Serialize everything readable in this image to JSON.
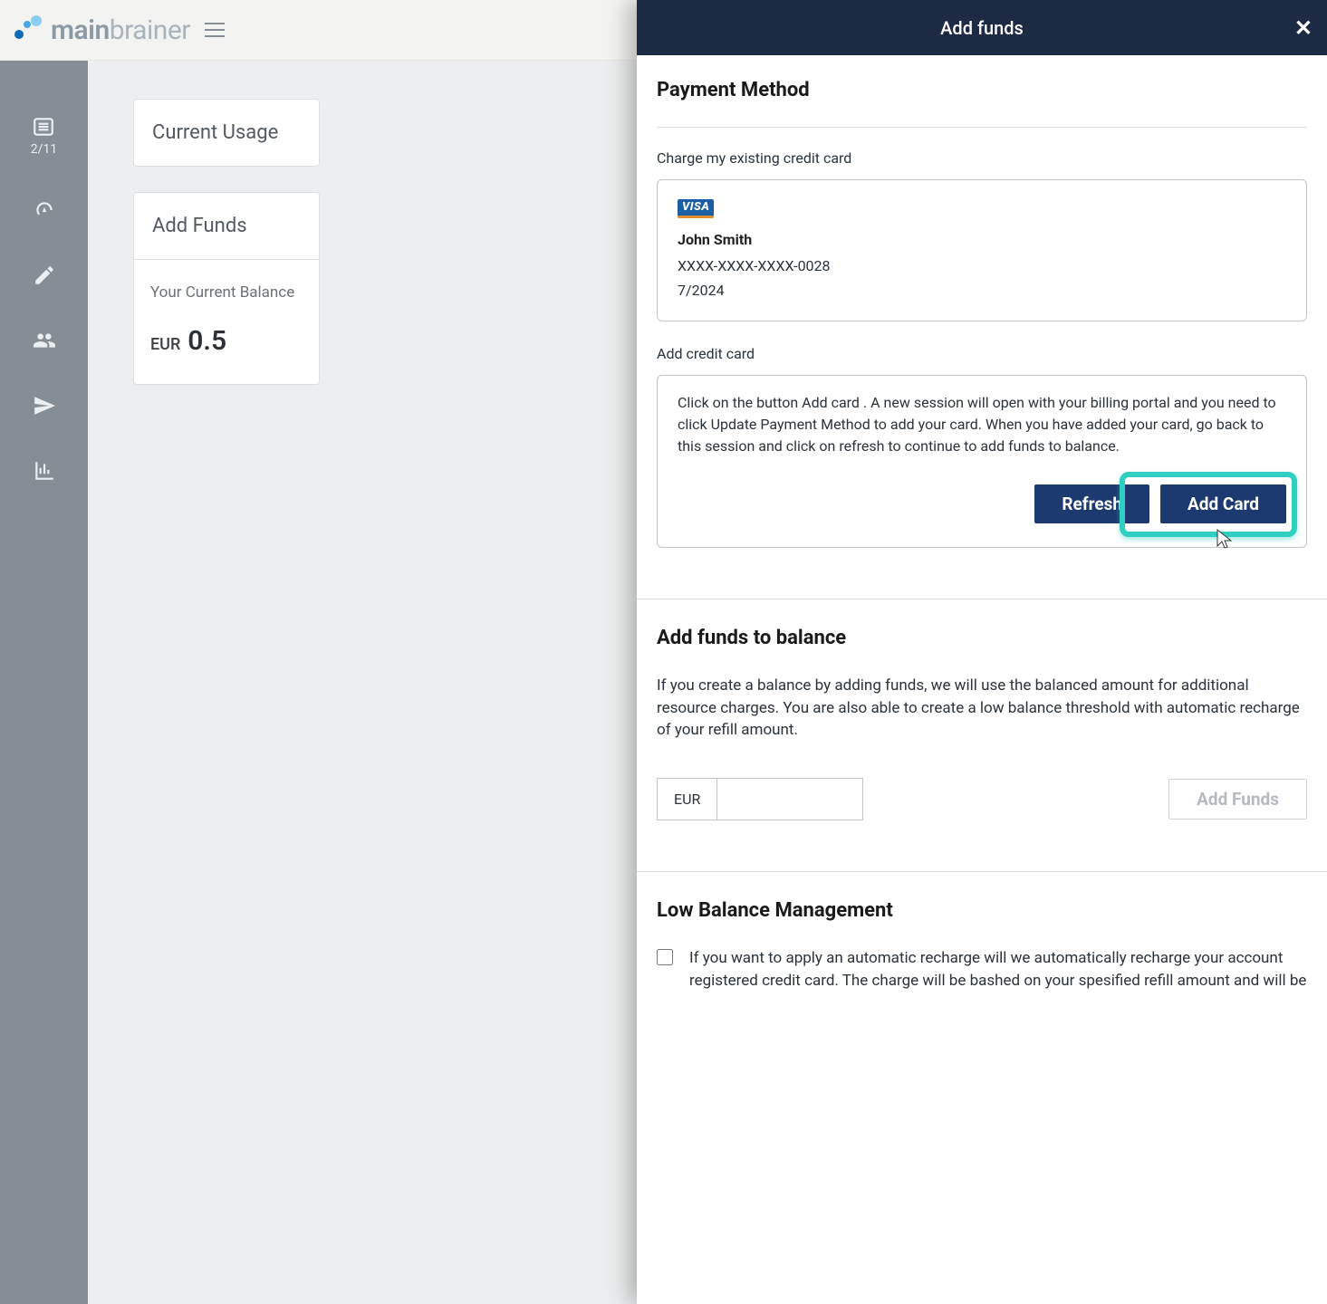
{
  "topbar": {
    "logo_main": "main",
    "logo_rest": "brainer"
  },
  "sidebar": {
    "counter": "2/11"
  },
  "bg": {
    "usage_title": "Current Usage",
    "addfunds_title": "Add Funds",
    "balance_label": "Your Current Balance",
    "balance_currency": "EUR",
    "balance_value": "0.5"
  },
  "panel": {
    "title": "Add funds",
    "pm_title": "Payment Method",
    "existing_label": "Charge my existing credit card",
    "card": {
      "brand": "VISA",
      "name": "John Smith",
      "number": "XXXX-XXXX-XXXX-0028",
      "expiry": "7/2024"
    },
    "addcard_label": "Add credit card",
    "addcard_instructions": "Click on the button Add card . A new session will open with your billing portal and you need to click Update Payment Method to add your card. When you have added your card, go back to this session and click on refresh to continue to add funds to balance.",
    "refresh_btn": "Refresh",
    "addcard_btn": "Add Card",
    "addfunds_title": "Add funds to balance",
    "addfunds_para": "If you create a balance by adding funds, we will use the balanced amount for additional resource charges. You are also able to create a low balance threshold with automatic recharge of your refill amount.",
    "amount_currency": "EUR",
    "amount_value": "",
    "addfunds_btn": "Add Funds",
    "lowbal_title": "Low Balance Management",
    "lowbal_text": "If you want to apply an automatic recharge will we automatically recharge your account registered credit card. The charge will be bashed on your spesified refill amount and will be"
  }
}
